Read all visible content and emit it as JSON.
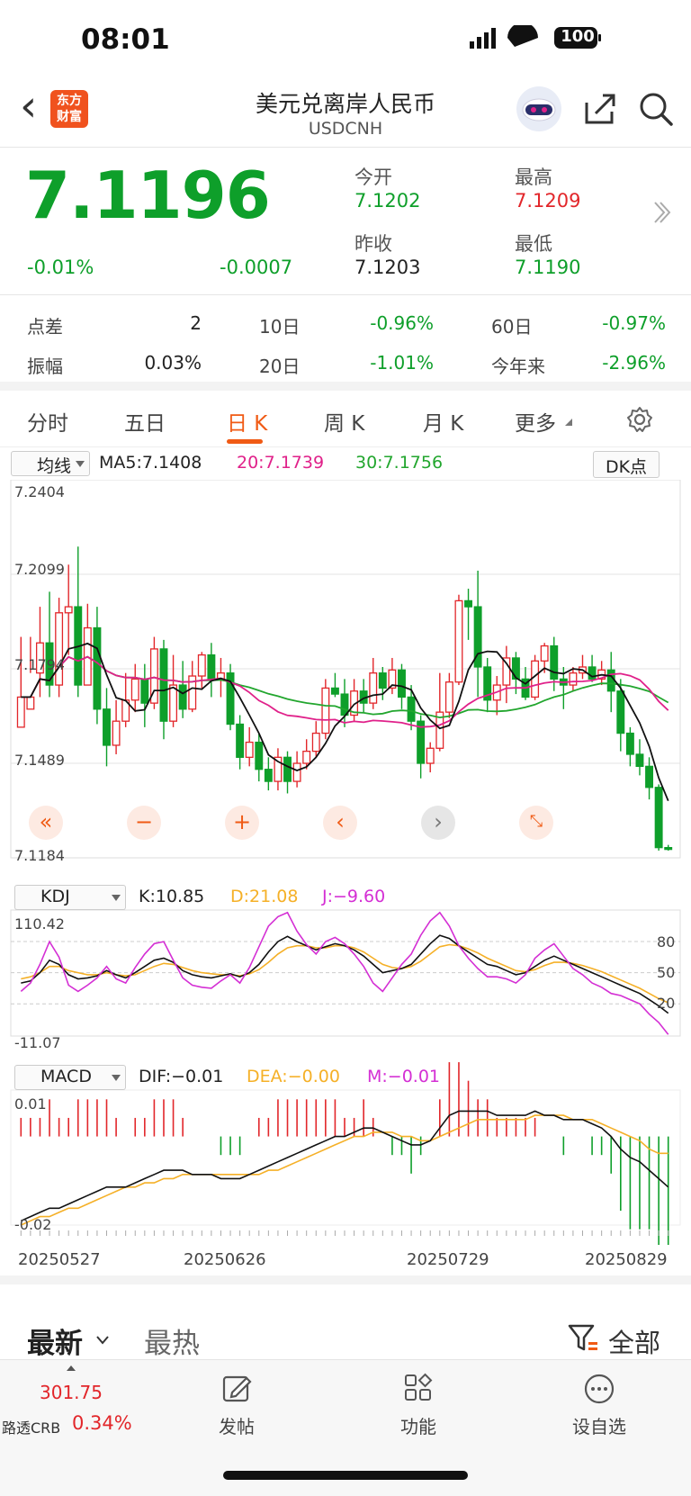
{
  "status_bar": {
    "time": "08:01",
    "battery": "100"
  },
  "header": {
    "back": "‹",
    "logo_line1": "东方",
    "logo_line2": "财富",
    "title": "美元兑离岸人民币",
    "subtitle": "USDCNH"
  },
  "quote": {
    "price": "7.1196",
    "change_pct": "-0.01%",
    "change": "-0.0007",
    "open_label": "今开",
    "open": "7.1202",
    "high_label": "最高",
    "high": "7.1209",
    "prev_close_label": "昨收",
    "prev_close": "7.1203",
    "low_label": "最低",
    "low": "7.1190"
  },
  "stats": {
    "row1": [
      {
        "label": "点差",
        "value": "2"
      },
      {
        "label": "10日",
        "value": "-0.96%"
      },
      {
        "label": "60日",
        "value": "-0.97%"
      }
    ],
    "row2": [
      {
        "label": "振幅",
        "value": "0.03%"
      },
      {
        "label": "20日",
        "value": "-1.01%"
      },
      {
        "label": "今年来",
        "value": "-2.96%"
      }
    ]
  },
  "tabs": [
    "分时",
    "五日",
    "日 K",
    "周 K",
    "月 K",
    "更多"
  ],
  "active_tab": "日 K",
  "colors": {
    "up": "#e2262a",
    "down": "#0e9f2a",
    "accent": "#f05a14",
    "ma5": "#111111",
    "ma20": "#e0218a",
    "ma30": "#22a62e",
    "dea": "#f5b027",
    "j": "#d42fd4"
  },
  "kline_indicator": {
    "selector": "均线",
    "ma5": "MA5:7.1408",
    "ma20": "20:7.1739",
    "ma30": "30:7.1756",
    "dk": "DK点",
    "y_labels": [
      "7.2404",
      "7.2099",
      "7.1794",
      "7.1489",
      "7.1184"
    ]
  },
  "kdj": {
    "selector": "KDJ",
    "k": "K:10.85",
    "d": "D:21.08",
    "j": "J:−9.60",
    "top": "110.42",
    "bottom": "-11.07",
    "levels": [
      "80",
      "50",
      "20"
    ]
  },
  "macd": {
    "selector": "MACD",
    "dif": "DIF:−0.01",
    "dea": "DEA:−0.00",
    "m": "M:−0.01",
    "top": "0.01",
    "bottom": "-0.02"
  },
  "dates": [
    "20250527",
    "20250626",
    "20250729",
    "20250829"
  ],
  "feed_tabs": {
    "latest": "最新",
    "hot": "最热",
    "filter": "全部"
  },
  "tabbar": {
    "ticker_value": "301.75",
    "ticker_name": "路透CRB",
    "ticker_pct": "0.34%",
    "post": "发帖",
    "func": "功能",
    "watch": "设自选"
  },
  "chart_data": {
    "type": "candlestick",
    "ylim": [
      7.1184,
      7.2404
    ],
    "candles": [
      [
        7.16,
        7.17,
        7.165,
        7.19
      ],
      [
        7.166,
        7.17,
        7.178,
        7.19
      ],
      [
        7.178,
        7.188,
        7.17,
        7.2
      ],
      [
        7.188,
        7.174,
        7.17,
        7.205
      ],
      [
        7.174,
        7.198,
        7.17,
        7.203
      ],
      [
        7.198,
        7.2,
        7.184,
        7.214
      ],
      [
        7.2,
        7.174,
        7.17,
        7.22
      ],
      [
        7.174,
        7.193,
        7.182,
        7.201
      ],
      [
        7.193,
        7.166,
        7.161,
        7.2
      ],
      [
        7.166,
        7.154,
        7.147,
        7.173
      ],
      [
        7.154,
        7.162,
        7.151,
        7.169
      ],
      [
        7.162,
        7.169,
        7.16,
        7.178
      ],
      [
        7.169,
        7.176,
        7.165,
        7.181
      ],
      [
        7.176,
        7.168,
        7.16,
        7.181
      ],
      [
        7.168,
        7.186,
        7.166,
        7.19
      ],
      [
        7.186,
        7.162,
        7.156,
        7.189
      ],
      [
        7.162,
        7.174,
        7.16,
        7.184
      ],
      [
        7.174,
        7.166,
        7.163,
        7.182
      ],
      [
        7.166,
        7.177,
        7.165,
        7.182
      ],
      [
        7.177,
        7.184,
        7.173,
        7.185
      ],
      [
        7.184,
        7.176,
        7.17,
        7.188
      ],
      [
        7.176,
        7.178,
        7.17,
        7.183
      ],
      [
        7.178,
        7.161,
        7.159,
        7.181
      ],
      [
        7.161,
        7.15,
        7.146,
        7.164
      ],
      [
        7.15,
        7.155,
        7.147,
        7.16
      ],
      [
        7.155,
        7.146,
        7.142,
        7.158
      ],
      [
        7.146,
        7.142,
        7.139,
        7.15
      ],
      [
        7.142,
        7.15,
        7.139,
        7.153
      ],
      [
        7.15,
        7.142,
        7.138,
        7.152
      ],
      [
        7.142,
        7.148,
        7.14,
        7.152
      ],
      [
        7.148,
        7.152,
        7.146,
        7.156
      ],
      [
        7.152,
        7.158,
        7.15,
        7.162
      ],
      [
        7.158,
        7.173,
        7.156,
        7.176
      ],
      [
        7.173,
        7.171,
        7.17,
        7.178
      ],
      [
        7.171,
        7.164,
        7.16,
        7.176
      ],
      [
        7.164,
        7.172,
        7.162,
        7.176
      ],
      [
        7.172,
        7.168,
        7.165,
        7.176
      ],
      [
        7.168,
        7.178,
        7.166,
        7.183
      ],
      [
        7.178,
        7.173,
        7.169,
        7.18
      ],
      [
        7.173,
        7.179,
        7.171,
        7.183
      ],
      [
        7.179,
        7.17,
        7.166,
        7.181
      ],
      [
        7.17,
        7.162,
        7.159,
        7.174
      ],
      [
        7.162,
        7.148,
        7.143,
        7.164
      ],
      [
        7.148,
        7.153,
        7.145,
        7.155
      ],
      [
        7.153,
        7.165,
        7.152,
        7.178
      ],
      [
        7.165,
        7.175,
        7.163,
        7.178
      ],
      [
        7.175,
        7.202,
        7.174,
        7.204
      ],
      [
        7.202,
        7.2,
        7.189,
        7.206
      ],
      [
        7.2,
        7.18,
        7.17,
        7.212
      ],
      [
        7.18,
        7.169,
        7.165,
        7.183
      ],
      [
        7.169,
        7.174,
        7.164,
        7.177
      ],
      [
        7.174,
        7.183,
        7.168,
        7.187
      ],
      [
        7.183,
        7.176,
        7.171,
        7.185
      ],
      [
        7.176,
        7.17,
        7.169,
        7.18
      ],
      [
        7.17,
        7.182,
        7.169,
        7.184
      ],
      [
        7.182,
        7.187,
        7.178,
        7.188
      ],
      [
        7.187,
        7.176,
        7.172,
        7.19
      ],
      [
        7.176,
        7.174,
        7.166,
        7.18
      ],
      [
        7.174,
        7.178,
        7.172,
        7.18
      ],
      [
        7.178,
        7.18,
        7.176,
        7.184
      ],
      [
        7.18,
        7.176,
        7.175,
        7.184
      ],
      [
        7.176,
        7.179,
        7.174,
        7.182
      ],
      [
        7.179,
        7.172,
        7.165,
        7.185
      ],
      [
        7.172,
        7.158,
        7.152,
        7.176
      ],
      [
        7.158,
        7.151,
        7.147,
        7.16
      ],
      [
        7.151,
        7.147,
        7.144,
        7.156
      ],
      [
        7.147,
        7.14,
        7.136,
        7.15
      ],
      [
        7.14,
        7.12,
        7.119,
        7.141
      ],
      [
        7.12,
        7.1196,
        7.119,
        7.1209
      ]
    ],
    "ma5_label": "MA5",
    "ma20_label": "20",
    "ma30_label": "30",
    "kdj_k": [
      40,
      42,
      50,
      62,
      58,
      48,
      44,
      45,
      47,
      52,
      48,
      45,
      50,
      56,
      62,
      64,
      60,
      52,
      48,
      46,
      45,
      47,
      49,
      46,
      50,
      58,
      70,
      80,
      85,
      80,
      76,
      72,
      75,
      78,
      76,
      72,
      66,
      58,
      50,
      52,
      54,
      58,
      68,
      78,
      86,
      83,
      76,
      70,
      64,
      58,
      56,
      52,
      48,
      50,
      56,
      62,
      66,
      62,
      58,
      54,
      50,
      46,
      42,
      38,
      34,
      30,
      24,
      18,
      11
    ],
    "kdj_d": [
      44,
      46,
      50,
      56,
      56,
      52,
      50,
      48,
      48,
      50,
      48,
      47,
      48,
      52,
      56,
      59,
      58,
      55,
      52,
      50,
      49,
      48,
      48,
      47,
      49,
      53,
      60,
      68,
      74,
      76,
      76,
      74,
      74,
      76,
      76,
      74,
      70,
      64,
      58,
      55,
      54,
      56,
      61,
      68,
      75,
      77,
      76,
      73,
      69,
      64,
      60,
      56,
      52,
      51,
      53,
      57,
      60,
      60,
      59,
      57,
      54,
      51,
      47,
      43,
      39,
      35,
      30,
      25,
      21
    ],
    "kdj_j": [
      32,
      40,
      58,
      80,
      65,
      38,
      32,
      38,
      45,
      56,
      44,
      40,
      55,
      68,
      78,
      80,
      62,
      45,
      38,
      36,
      35,
      42,
      48,
      40,
      55,
      75,
      95,
      104,
      108,
      90,
      77,
      68,
      80,
      84,
      78,
      68,
      56,
      40,
      32,
      45,
      58,
      68,
      86,
      100,
      108,
      95,
      76,
      64,
      54,
      46,
      46,
      44,
      40,
      48,
      64,
      72,
      78,
      66,
      54,
      48,
      40,
      36,
      30,
      28,
      24,
      20,
      10,
      2,
      -9.6
    ],
    "macd_dif": [
      -0.02,
      -0.019,
      -0.018,
      -0.017,
      -0.017,
      -0.016,
      -0.015,
      -0.014,
      -0.013,
      -0.012,
      -0.012,
      -0.012,
      -0.011,
      -0.01,
      -0.009,
      -0.008,
      -0.008,
      -0.008,
      -0.009,
      -0.009,
      -0.009,
      -0.01,
      -0.01,
      -0.01,
      -0.009,
      -0.008,
      -0.007,
      -0.006,
      -0.005,
      -0.004,
      -0.003,
      -0.002,
      -0.001,
      0.0,
      0.0,
      0.001,
      0.002,
      0.002,
      0.001,
      0.0,
      -0.001,
      -0.002,
      -0.002,
      -0.001,
      0.002,
      0.005,
      0.006,
      0.006,
      0.006,
      0.006,
      0.005,
      0.005,
      0.005,
      0.005,
      0.006,
      0.005,
      0.005,
      0.004,
      0.004,
      0.004,
      0.003,
      0.002,
      0.0,
      -0.003,
      -0.005,
      -0.006,
      -0.008,
      -0.01,
      -0.012
    ],
    "macd_dea": [
      -0.021,
      -0.02,
      -0.019,
      -0.019,
      -0.018,
      -0.017,
      -0.017,
      -0.016,
      -0.015,
      -0.014,
      -0.013,
      -0.012,
      -0.012,
      -0.011,
      -0.011,
      -0.01,
      -0.01,
      -0.009,
      -0.009,
      -0.009,
      -0.009,
      -0.009,
      -0.009,
      -0.009,
      -0.009,
      -0.009,
      -0.008,
      -0.008,
      -0.007,
      -0.006,
      -0.005,
      -0.004,
      -0.003,
      -0.002,
      -0.001,
      0.0,
      0.0,
      0.001,
      0.001,
      0.001,
      0.0,
      0.0,
      -0.001,
      -0.001,
      0.0,
      0.001,
      0.002,
      0.003,
      0.004,
      0.004,
      0.004,
      0.004,
      0.004,
      0.004,
      0.005,
      0.005,
      0.005,
      0.005,
      0.004,
      0.004,
      0.004,
      0.003,
      0.002,
      0.001,
      0.0,
      -0.001,
      -0.003,
      -0.004,
      -0.004
    ]
  }
}
